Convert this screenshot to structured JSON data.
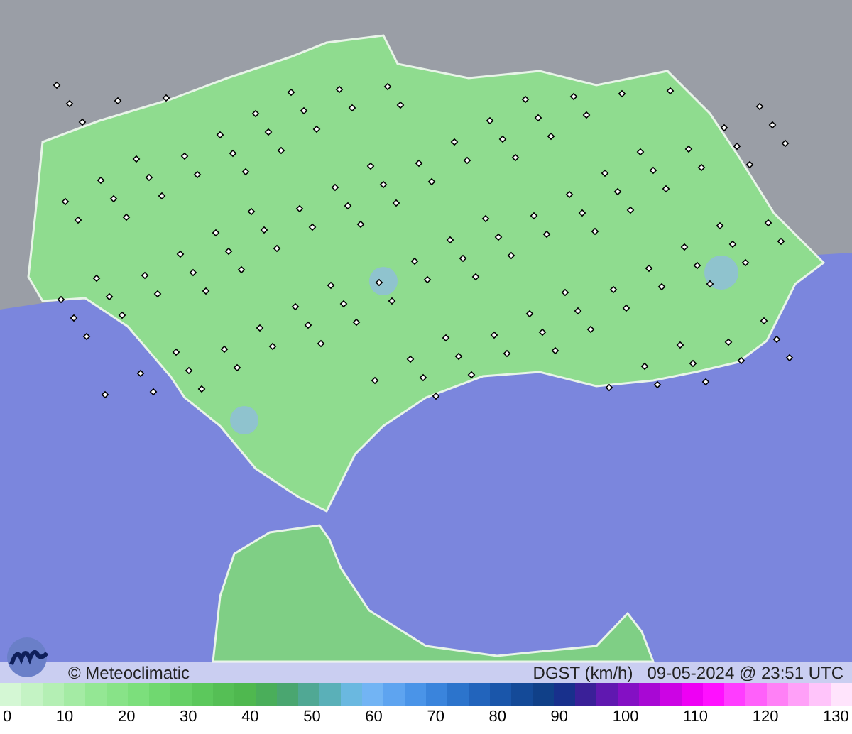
{
  "map": {
    "credit": "© Meteoclimatic",
    "variable": "DGST (km/h)",
    "timestamp": "09-05-2024 @ 23:51 UTC"
  },
  "legend": {
    "swatches": [
      {
        "color": "#d4f7d4"
      },
      {
        "color": "#c4f3c4"
      },
      {
        "color": "#b4efb4"
      },
      {
        "color": "#a4eba4"
      },
      {
        "color": "#94e794"
      },
      {
        "color": "#88e388"
      },
      {
        "color": "#7cdf7c"
      },
      {
        "color": "#70d870"
      },
      {
        "color": "#66d066"
      },
      {
        "color": "#5cc85c"
      },
      {
        "color": "#55bf55"
      },
      {
        "color": "#4fb84f"
      },
      {
        "color": "#4aae5a"
      },
      {
        "color": "#4aa670"
      },
      {
        "color": "#50a894"
      },
      {
        "color": "#5ab0b8"
      },
      {
        "color": "#6ab8e0"
      },
      {
        "color": "#72b4f4"
      },
      {
        "color": "#5ea4f0"
      },
      {
        "color": "#4a94e8"
      },
      {
        "color": "#3a84dc"
      },
      {
        "color": "#2c74cc"
      },
      {
        "color": "#2264bc"
      },
      {
        "color": "#1a56aa"
      },
      {
        "color": "#144a98"
      },
      {
        "color": "#104088"
      },
      {
        "color": "#18308c"
      },
      {
        "color": "#3a2098"
      },
      {
        "color": "#6018b0"
      },
      {
        "color": "#8410c4"
      },
      {
        "color": "#a808d4"
      },
      {
        "color": "#cc04e4"
      },
      {
        "color": "#ee00f4"
      },
      {
        "color": "#ff10ff"
      },
      {
        "color": "#ff3cff"
      },
      {
        "color": "#ff60fa"
      },
      {
        "color": "#ff80f6"
      },
      {
        "color": "#ffa0f8"
      },
      {
        "color": "#ffc4fa"
      },
      {
        "color": "#ffe4fc"
      }
    ],
    "ticks": [
      "0",
      "10",
      "20",
      "30",
      "40",
      "50",
      "60",
      "70",
      "80",
      "90",
      "100",
      "110",
      "120",
      "130"
    ]
  }
}
